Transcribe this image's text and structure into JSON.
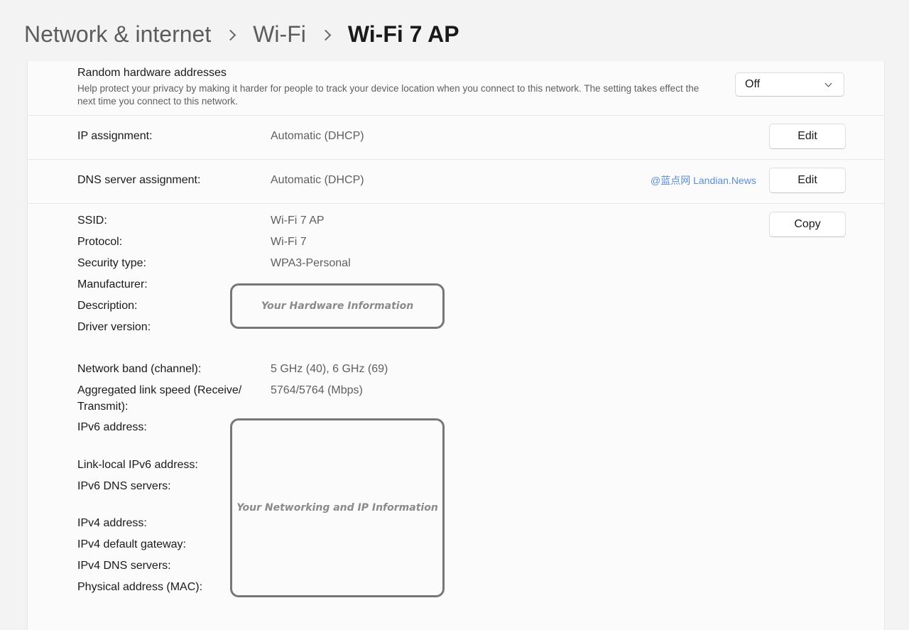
{
  "breadcrumb": {
    "items": [
      "Network & internet",
      "Wi-Fi"
    ],
    "current": "Wi-Fi 7 AP"
  },
  "random_hw": {
    "title": "Random hardware addresses",
    "description": "Help protect your privacy by making it harder for people to track your device location when you connect to this network. The setting takes effect the next time you connect to this network.",
    "selected": "Off"
  },
  "ip_assignment": {
    "label": "IP assignment:",
    "value": "Automatic (DHCP)",
    "button": "Edit"
  },
  "dns_assignment": {
    "label": "DNS server assignment:",
    "value": "Automatic (DHCP)",
    "button": "Edit"
  },
  "watermark": "@蓝点网 Landian.News",
  "properties": {
    "copy_button": "Copy",
    "rows": [
      {
        "label": "SSID:",
        "value": "Wi-Fi 7 AP"
      },
      {
        "label": "Protocol:",
        "value": "Wi-Fi 7"
      },
      {
        "label": "Security type:",
        "value": "WPA3-Personal"
      },
      {
        "label": "Manufacturer:",
        "value": ""
      },
      {
        "label": "Description:",
        "value": ""
      },
      {
        "label": "Driver version:",
        "value": ""
      },
      {
        "label": "Network band (channel):",
        "value": "5 GHz (40), 6 GHz (69)"
      },
      {
        "label": "Aggregated link speed (Receive/",
        "value": "5764/5764 (Mbps)"
      },
      {
        "label": "Transmit):",
        "value": ""
      },
      {
        "label": "IPv6 address:",
        "value": ""
      },
      {
        "label": "Link-local IPv6 address:",
        "value": ""
      },
      {
        "label": "IPv6 DNS servers:",
        "value": ""
      },
      {
        "label": "IPv4 address:",
        "value": ""
      },
      {
        "label": "IPv4 default gateway:",
        "value": ""
      },
      {
        "label": "IPv4 DNS servers:",
        "value": ""
      },
      {
        "label": "Physical address (MAC):",
        "value": ""
      }
    ],
    "hardware_redaction": "Your Hardware Information",
    "network_redaction": "Your Networking and IP Information"
  },
  "colors": {
    "background": "#f3f3f3",
    "panel": "#fbfbfb",
    "watermark": "#5b8ed6",
    "redaction_border": "#777777"
  }
}
